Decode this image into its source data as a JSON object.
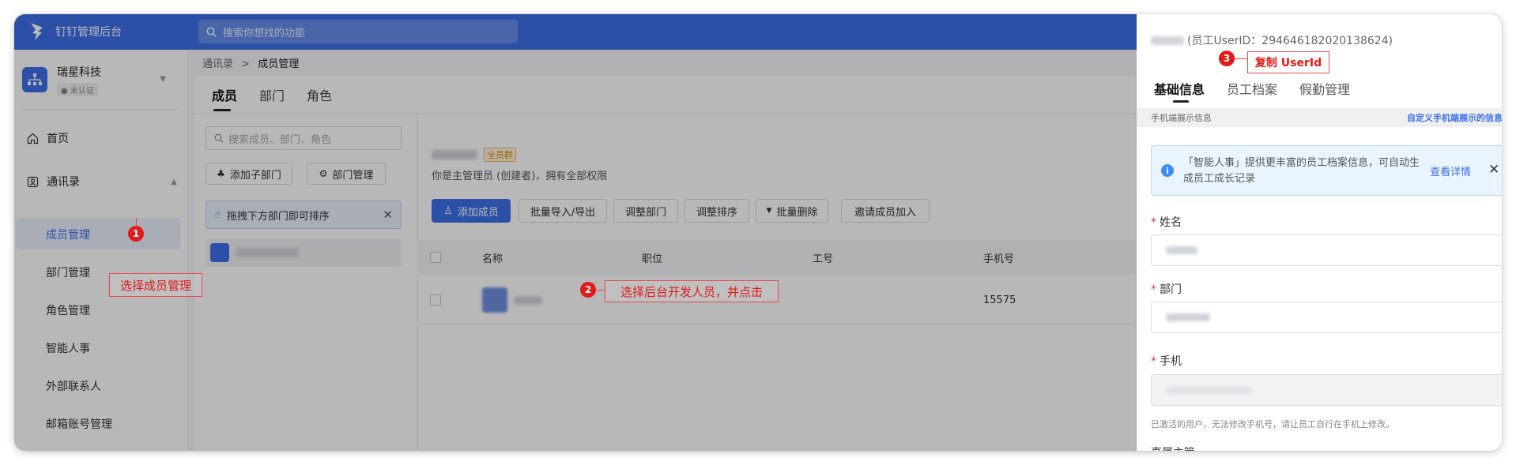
{
  "app": {
    "title": "钉钉管理后台",
    "search_placeholder": "搜索你想找的功能"
  },
  "org": {
    "name": "瑞星科技",
    "badge": "未认证"
  },
  "sidebar": {
    "home": "首页",
    "contacts": "通讯录",
    "items": [
      "成员管理",
      "部门管理",
      "角色管理",
      "智能人事",
      "外部联系人",
      "邮箱账号管理"
    ]
  },
  "breadcrumb": {
    "parent": "通讯录",
    "separator": ">",
    "current": "成员管理"
  },
  "main_tabs": [
    "成员",
    "部门",
    "角色"
  ],
  "left_panel": {
    "search_placeholder": "搜索成员、部门、角色",
    "add_sub_dept": "添加子部门",
    "dept_manage": "部门管理",
    "drag_hint": "拖拽下方部门即可排序"
  },
  "org_tag": "全员群",
  "admin_note": "你是主管理员 (创建者)，拥有全部权限",
  "toolbar": {
    "add_member": "添加成员",
    "batch_import": "批量导入/导出",
    "adjust_dept": "调整部门",
    "adjust_order": "调整排序",
    "batch_delete": "批量删除",
    "invite": "邀请成员加入"
  },
  "table": {
    "columns": [
      "名称",
      "职位",
      "工号",
      "手机号"
    ],
    "rows": [
      {
        "phone": "15575"
      }
    ]
  },
  "drawer": {
    "title": "(员工UserID：294646182020138624)",
    "tabs": [
      "基础信息",
      "员工档案",
      "假勤管理"
    ],
    "section": "手机端展示信息",
    "section_link": "自定义手机端展示的信息",
    "info_text": "「智能人事」提供更丰富的员工档案信息，可自动生成员工成长记录",
    "info_more": "查看详情",
    "fields": {
      "name": "姓名",
      "dept": "部门",
      "phone": "手机"
    },
    "phone_hint": "已激活的用户，无法修改手机号，请让员工自行在手机上修改。",
    "next_label": "直属主管"
  },
  "annotations": [
    {
      "num": "1",
      "text": "选择成员管理"
    },
    {
      "num": "2",
      "text": "选择后台开发人员，并点击"
    },
    {
      "num": "3",
      "text": "复制 UserId"
    }
  ],
  "icons": {
    "logo": "dingtalk-logo-icon",
    "search": "search-icon",
    "home": "home-icon",
    "contacts": "contacts-icon",
    "close": "close-icon",
    "info": "info-icon"
  }
}
